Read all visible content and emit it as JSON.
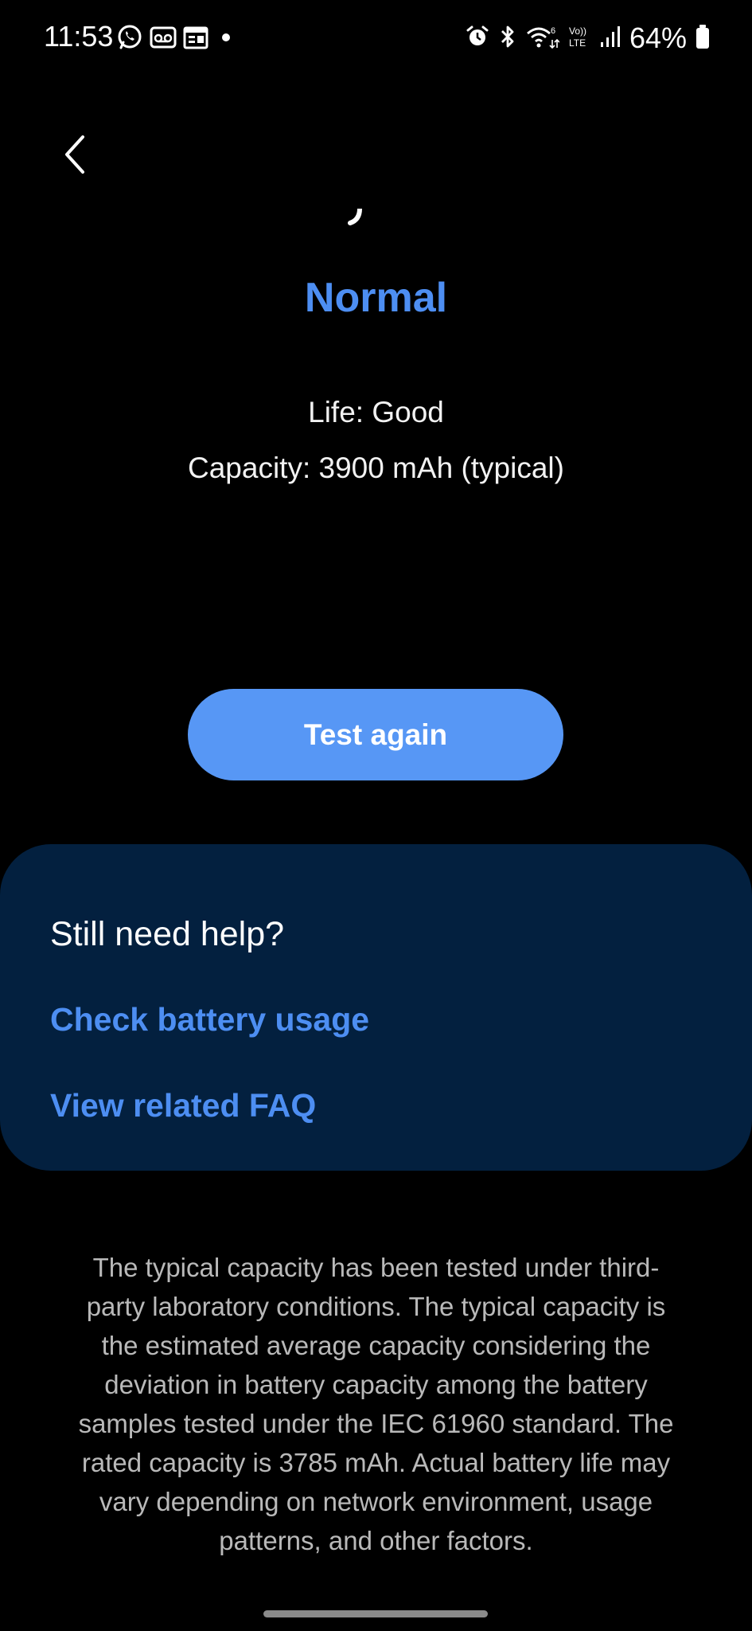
{
  "status_bar": {
    "time": "11:53",
    "battery_percent": "64%",
    "lte_label_top": "Vo))",
    "lte_label_bottom": "LTE",
    "wifi_label": "6",
    "left_icons": [
      "whatsapp-icon",
      "voicemail-icon",
      "calendar-icon",
      "dot-icon"
    ],
    "right_icons": [
      "alarm-icon",
      "bluetooth-icon",
      "wifi-6-icon",
      "volte-icon",
      "signal-icon",
      "battery-icon"
    ]
  },
  "nav": {
    "back_icon": "chevron-left-icon"
  },
  "result": {
    "status": "Normal",
    "life": "Life: Good",
    "capacity": "Capacity: 3900 mAh (typical)"
  },
  "actions": {
    "test_again_label": "Test again"
  },
  "help": {
    "title": "Still need help?",
    "links": [
      {
        "label": "Check battery usage"
      },
      {
        "label": "View related FAQ"
      }
    ]
  },
  "disclaimer": "The typical capacity has been tested under third-party laboratory conditions. The typical capacity is the estimated average capacity considering the deviation in battery capacity among the battery samples tested under the IEC 61960 standard. The rated capacity is 3785 mAh. Actual battery life may vary depending on network environment, usage patterns, and other factors.",
  "colors": {
    "background": "#000000",
    "accent": "#4d8ef2",
    "button": "#5797f5",
    "card": "#03203f",
    "disclaimer_text": "#b9b9b9"
  }
}
